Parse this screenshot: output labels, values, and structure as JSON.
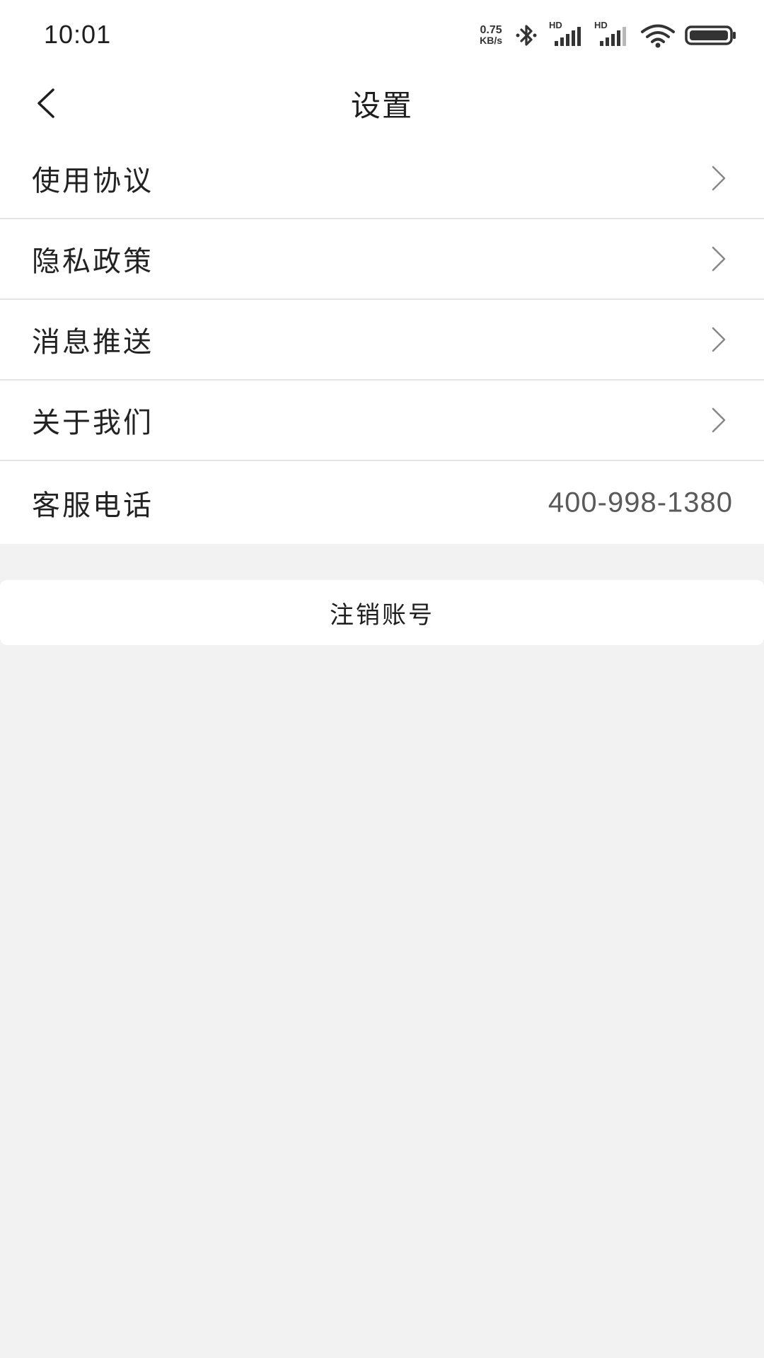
{
  "status_bar": {
    "time": "10:01",
    "net_speed_value": "0.75",
    "net_speed_unit": "KB/s",
    "signal_1_label": "HD",
    "signal_2_label": "HD",
    "icons": [
      "bluetooth-icon",
      "signal-icon",
      "signal-icon",
      "wifi-icon",
      "battery-icon"
    ]
  },
  "nav": {
    "title": "设置",
    "back_icon": "back-arrow-icon"
  },
  "settings": {
    "items": [
      {
        "label": "使用协议",
        "icon": "chevron-right-icon"
      },
      {
        "label": "隐私政策",
        "icon": "chevron-right-icon"
      },
      {
        "label": "消息推送",
        "icon": "chevron-right-icon"
      },
      {
        "label": "关于我们",
        "icon": "chevron-right-icon"
      },
      {
        "label": "客服电话",
        "value": "400-998-1380"
      }
    ]
  },
  "actions": {
    "logout_label": "注销账号"
  },
  "colors": {
    "background": "#f2f2f2",
    "card": "#ffffff",
    "divider": "#e4e4e4",
    "text_primary": "#222222",
    "text_secondary": "#5a5a5a"
  }
}
